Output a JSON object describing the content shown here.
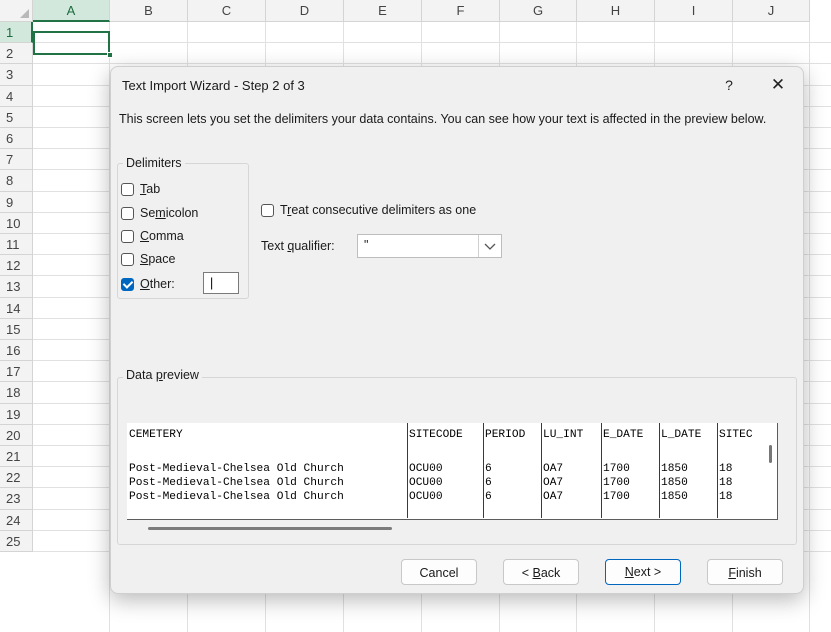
{
  "spreadsheet": {
    "columns": [
      "A",
      "B",
      "C",
      "D",
      "E",
      "F",
      "G",
      "H",
      "I",
      "J"
    ],
    "rows": [
      "1",
      "2",
      "3",
      "4",
      "5",
      "6",
      "7",
      "8",
      "9",
      "10",
      "11",
      "12",
      "13",
      "14",
      "15",
      "16",
      "17",
      "18",
      "19",
      "20",
      "21",
      "22",
      "23",
      "24",
      "25"
    ]
  },
  "dialog": {
    "title": "Text Import Wizard - Step 2 of 3",
    "help_label": "?",
    "close_label": "✕",
    "description": "This screen lets you set the delimiters your data contains.  You can see how your text is affected in the preview below.",
    "delimiters": {
      "legend": "Delimiters",
      "tab": {
        "pre": "",
        "key": "T",
        "post": "ab",
        "checked": false
      },
      "semicolon": {
        "pre": "Se",
        "key": "m",
        "post": "icolon",
        "checked": false
      },
      "comma": {
        "pre": "",
        "key": "C",
        "post": "omma",
        "checked": false
      },
      "space": {
        "pre": "",
        "key": "S",
        "post": "pace",
        "checked": false
      },
      "other": {
        "pre": "",
        "key": "O",
        "post": "ther:",
        "checked": true,
        "value": "|"
      }
    },
    "consecutive": {
      "pre": "T",
      "key": "r",
      "post": "eat consecutive delimiters as one",
      "checked": false
    },
    "qualifier": {
      "pre": "Text ",
      "key": "q",
      "post": "ualifier:",
      "value": "\""
    },
    "preview": {
      "legend_pre": "Data ",
      "legend_key": "p",
      "legend_post": "review",
      "headers": [
        "CEMETERY",
        "SITECODE",
        "PERIOD",
        "LU_INT",
        "E_DATE",
        "L_DATE",
        "SITEC"
      ],
      "rows": [
        [
          "Post-Medieval-Chelsea Old Church",
          "OCU00",
          "6",
          "OA7",
          "1700",
          "1850",
          "18"
        ],
        [
          "Post-Medieval-Chelsea Old Church",
          "OCU00",
          "6",
          "OA7",
          "1700",
          "1850",
          "18"
        ],
        [
          "Post-Medieval-Chelsea Old Church",
          "OCU00",
          "6",
          "OA7",
          "1700",
          "1850",
          "18"
        ]
      ]
    },
    "buttons": {
      "cancel": "Cancel",
      "back": {
        "pre": "< ",
        "key": "B",
        "post": "ack"
      },
      "next": {
        "pre": "",
        "key": "N",
        "post": "ext >"
      },
      "finish": {
        "pre": "",
        "key": "F",
        "post": "inish"
      }
    }
  }
}
